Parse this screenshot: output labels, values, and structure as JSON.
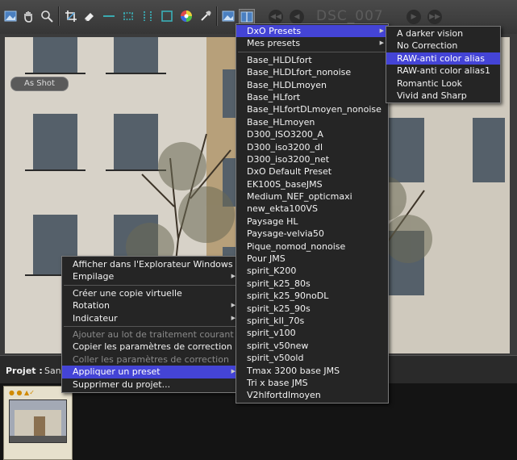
{
  "toolbar": {
    "image_name": "DSC_007",
    "icons": [
      "image-view-icon",
      "hand-icon",
      "zoom-icon",
      "crop-icon",
      "eraser-icon",
      "horizon-icon",
      "distortion-icon",
      "vertical-icon",
      "frame-icon",
      "color-wheel-icon",
      "eyedropper-icon",
      "compare-icon",
      "split-view-icon"
    ]
  },
  "viewer": {
    "badge": "As Shot"
  },
  "project": {
    "label": "Projet :",
    "name": "Sans"
  },
  "context_menu": {
    "items": [
      {
        "label": "Afficher dans l'Explorateur Windows",
        "state": "normal"
      },
      {
        "label": "Empilage",
        "state": "normal",
        "submenu": true
      },
      {
        "label": "Créer une copie virtuelle",
        "state": "normal"
      },
      {
        "label": "Rotation",
        "state": "normal",
        "submenu": true
      },
      {
        "label": "Indicateur",
        "state": "normal",
        "submenu": true
      },
      {
        "label": "Ajouter au lot de traitement courant",
        "state": "disabled"
      },
      {
        "label": "Copier les paramètres de correction",
        "state": "normal"
      },
      {
        "label": "Coller les paramètres de correction",
        "state": "disabled"
      },
      {
        "label": "Appliquer un preset",
        "state": "selected",
        "submenu": true
      },
      {
        "label": "Supprimer du projet...",
        "state": "normal"
      }
    ]
  },
  "preset_menu": {
    "items": [
      {
        "label": "DxO Presets",
        "state": "selected",
        "submenu": true
      },
      {
        "label": "Mes presets",
        "state": "normal",
        "submenu": true
      },
      {
        "label": "Base_HLDLfort"
      },
      {
        "label": "Base_HLDLfort_nonoise"
      },
      {
        "label": "Base_HLDLmoyen"
      },
      {
        "label": "Base_HLfort"
      },
      {
        "label": "Base_HLfortDLmoyen_nonoise"
      },
      {
        "label": "Base_HLmoyen"
      },
      {
        "label": "D300_ISO3200_A"
      },
      {
        "label": "D300_iso3200_dl"
      },
      {
        "label": "D300_iso3200_net"
      },
      {
        "label": "DxO Default Preset"
      },
      {
        "label": "EK100S_baseJMS"
      },
      {
        "label": "Medium_NEF_opticmaxi"
      },
      {
        "label": "new_ekta100VS"
      },
      {
        "label": "Paysage HL"
      },
      {
        "label": "Paysage-velvia50"
      },
      {
        "label": "Pique_nomod_nonoise"
      },
      {
        "label": "Pour JMS"
      },
      {
        "label": "spirit_K200"
      },
      {
        "label": "spirit_k25_80s"
      },
      {
        "label": "spirit_k25_90noDL"
      },
      {
        "label": "spirit_k25_90s"
      },
      {
        "label": "spirit_kII_70s"
      },
      {
        "label": "spirit_v100"
      },
      {
        "label": "spirit_v50new"
      },
      {
        "label": "spirit_v50old"
      },
      {
        "label": "Tmax 3200 base JMS"
      },
      {
        "label": "Tri x base JMS"
      },
      {
        "label": "V2hlfortdlmoyen"
      }
    ]
  },
  "dxo_submenu": {
    "items": [
      {
        "label": "A darker vision",
        "state": "normal"
      },
      {
        "label": "No Correction",
        "state": "normal"
      },
      {
        "label": "RAW-anti color alias",
        "state": "selected"
      },
      {
        "label": "RAW-anti color alias1",
        "state": "normal"
      },
      {
        "label": "Romantic Look",
        "state": "normal"
      },
      {
        "label": "Vivid and Sharp",
        "state": "normal"
      }
    ]
  }
}
